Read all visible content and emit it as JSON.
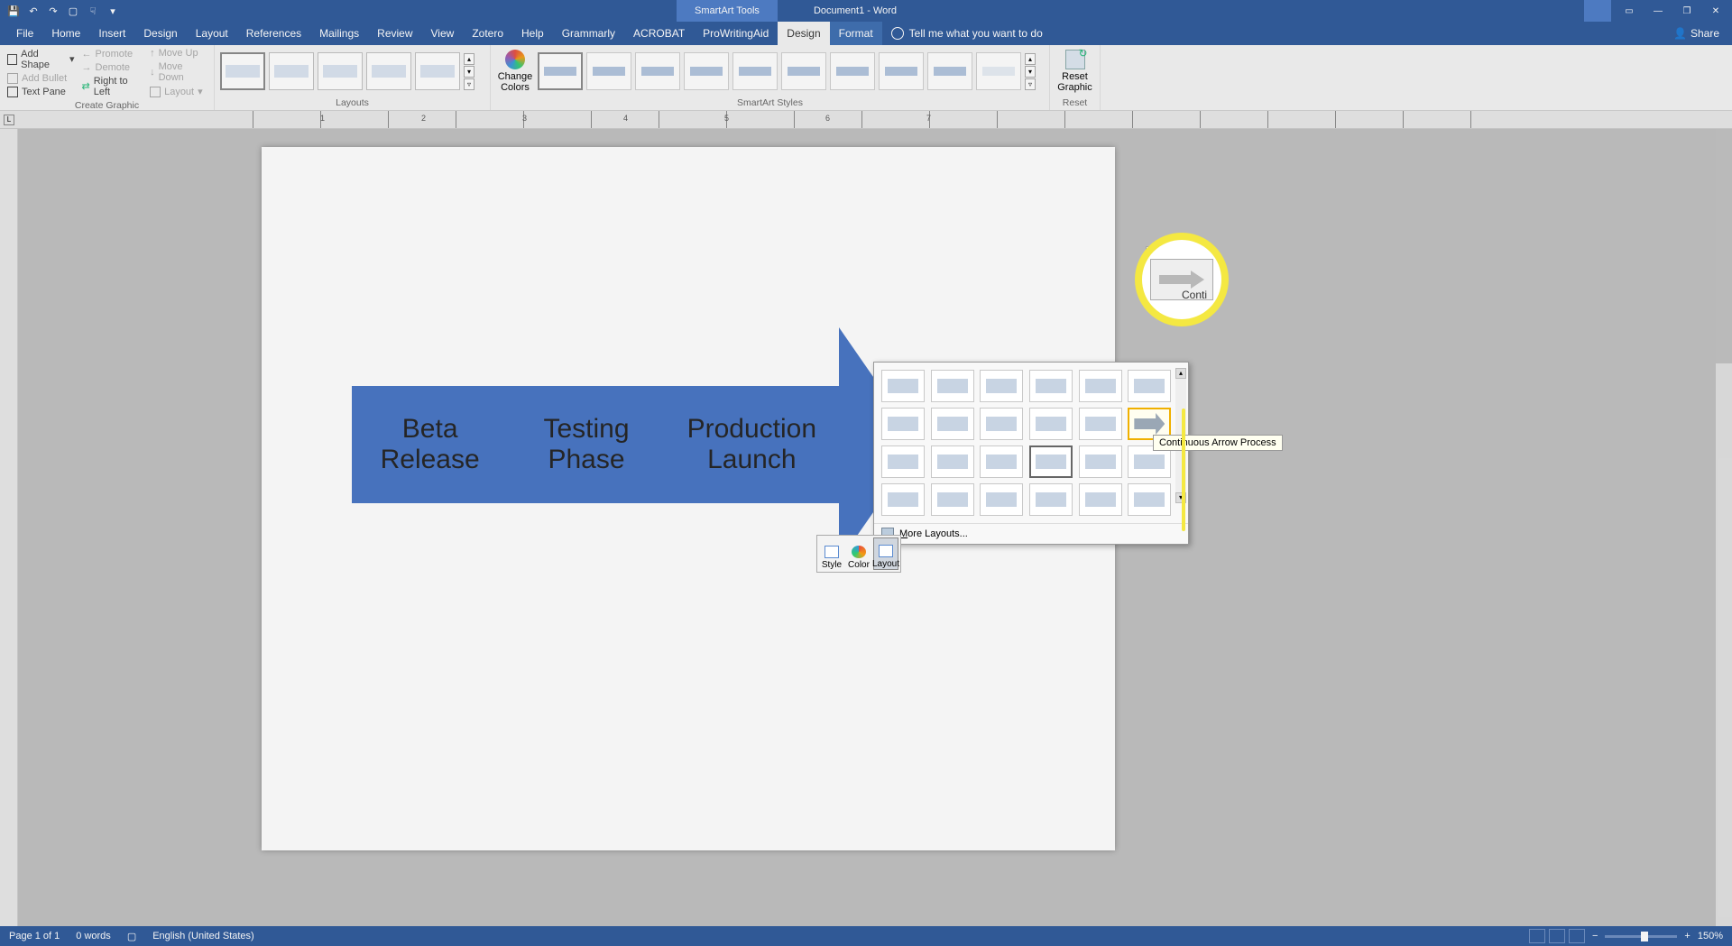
{
  "titlebar": {
    "doc_title": "Document1 - Word",
    "tool_tab": "SmartArt Tools"
  },
  "tabs": {
    "file": "File",
    "home": "Home",
    "insert": "Insert",
    "design": "Design",
    "layout": "Layout",
    "references": "References",
    "mailings": "Mailings",
    "review": "Review",
    "view": "View",
    "zotero": "Zotero",
    "help": "Help",
    "grammarly": "Grammarly",
    "acrobat": "ACROBAT",
    "prowritingaid": "ProWritingAid",
    "sa_design": "Design",
    "sa_format": "Format",
    "tellme": "Tell me what you want to do",
    "share": "Share"
  },
  "ribbon": {
    "create_graphic": {
      "label": "Create Graphic",
      "add_shape": "Add Shape",
      "add_bullet": "Add Bullet",
      "text_pane": "Text Pane",
      "promote": "Promote",
      "demote": "Demote",
      "rtl": "Right to Left",
      "move_up": "Move Up",
      "move_down": "Move Down",
      "layout_dd": "Layout"
    },
    "layouts_label": "Layouts",
    "change_colors": "Change Colors",
    "styles_label": "SmartArt Styles",
    "reset": {
      "label": "Reset",
      "btn": "Reset Graphic"
    }
  },
  "ruler": {
    "nums": [
      "1",
      "2",
      "3",
      "4",
      "5",
      "6",
      "7"
    ]
  },
  "smartart": {
    "items": [
      "Beta Release",
      "Testing Phase",
      "Production Launch"
    ]
  },
  "mini_toolbar": {
    "style": "Style",
    "color": "Color",
    "layout": "Layout"
  },
  "gallery": {
    "more": "More Layouts...",
    "more_key": "M"
  },
  "tooltip": {
    "text": "Continuous Arrow Process"
  },
  "callout": {
    "label": "Conti"
  },
  "statusbar": {
    "page": "Page 1 of 1",
    "words": "0 words",
    "lang": "English (United States)",
    "zoom": "150%"
  }
}
